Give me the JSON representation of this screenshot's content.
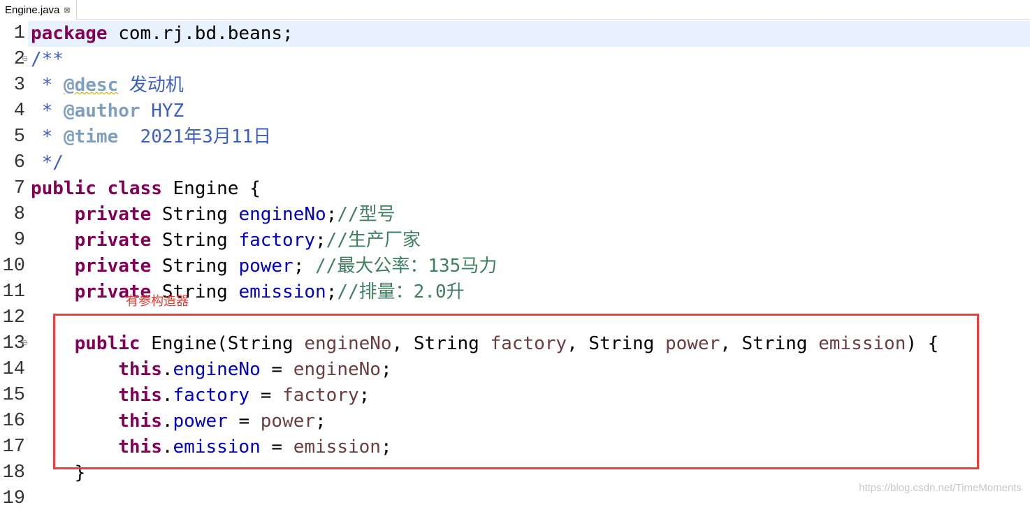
{
  "tab": {
    "title": "Engine.java",
    "close_glyph": "⊠"
  },
  "colors": {
    "keyword": "#7f0055",
    "javadoc": "#3f5fbf",
    "javadoc_tag": "#7f9fbf",
    "field": "#0000c0",
    "parameter": "#6a3e3e",
    "comment": "#3f7f5f",
    "current_line": "#e8f2fe",
    "annotation_red": "#e84040"
  },
  "fold_glyph": "⊖",
  "lines": [
    {
      "num": "1",
      "tokens": [
        {
          "t": "package",
          "c": "kw"
        },
        {
          "t": " com.rj.bd.beans;",
          "c": ""
        }
      ]
    },
    {
      "num": "2",
      "fold": true,
      "tokens": [
        {
          "t": "/**",
          "c": "jd"
        }
      ]
    },
    {
      "num": "3",
      "tokens": [
        {
          "t": " * ",
          "c": "jd"
        },
        {
          "t": "@desc",
          "c": "tag tag-warn"
        },
        {
          "t": " 发动机",
          "c": "jd"
        }
      ]
    },
    {
      "num": "4",
      "tokens": [
        {
          "t": " * ",
          "c": "jd"
        },
        {
          "t": "@author",
          "c": "tag"
        },
        {
          "t": " HYZ",
          "c": "jd"
        }
      ]
    },
    {
      "num": "5",
      "tokens": [
        {
          "t": " * ",
          "c": "jd"
        },
        {
          "t": "@time",
          "c": "tag"
        },
        {
          "t": "  2021年3月11日",
          "c": "jd"
        }
      ]
    },
    {
      "num": "6",
      "tokens": [
        {
          "t": " */",
          "c": "jd"
        }
      ]
    },
    {
      "num": "7",
      "tokens": [
        {
          "t": "public",
          "c": "kw"
        },
        {
          "t": " ",
          "c": ""
        },
        {
          "t": "class",
          "c": "kw"
        },
        {
          "t": " Engine {",
          "c": ""
        }
      ]
    },
    {
      "num": "8",
      "tokens": [
        {
          "t": "    ",
          "c": ""
        },
        {
          "t": "private",
          "c": "kw"
        },
        {
          "t": " String ",
          "c": ""
        },
        {
          "t": "engineNo",
          "c": "fld"
        },
        {
          "t": ";",
          "c": ""
        },
        {
          "t": "//型号",
          "c": "cmt"
        }
      ]
    },
    {
      "num": "9",
      "tokens": [
        {
          "t": "    ",
          "c": ""
        },
        {
          "t": "private",
          "c": "kw"
        },
        {
          "t": " String ",
          "c": ""
        },
        {
          "t": "factory",
          "c": "fld"
        },
        {
          "t": ";",
          "c": ""
        },
        {
          "t": "//生产厂家",
          "c": "cmt"
        }
      ]
    },
    {
      "num": "10",
      "tokens": [
        {
          "t": "    ",
          "c": ""
        },
        {
          "t": "private",
          "c": "kw"
        },
        {
          "t": " String ",
          "c": ""
        },
        {
          "t": "power",
          "c": "fld"
        },
        {
          "t": "; ",
          "c": ""
        },
        {
          "t": "//最大公率：135马力",
          "c": "cmt"
        }
      ]
    },
    {
      "num": "11",
      "tokens": [
        {
          "t": "    ",
          "c": ""
        },
        {
          "t": "private",
          "c": "kw"
        },
        {
          "t": " String ",
          "c": ""
        },
        {
          "t": "emission",
          "c": "fld"
        },
        {
          "t": ";",
          "c": ""
        },
        {
          "t": "//排量：2.0升",
          "c": "cmt"
        }
      ]
    },
    {
      "num": "12",
      "tokens": []
    },
    {
      "num": "13",
      "fold": true,
      "tokens": [
        {
          "t": "    ",
          "c": ""
        },
        {
          "t": "public",
          "c": "kw"
        },
        {
          "t": " Engine(String ",
          "c": ""
        },
        {
          "t": "engineNo",
          "c": "prm"
        },
        {
          "t": ", String ",
          "c": ""
        },
        {
          "t": "factory",
          "c": "prm"
        },
        {
          "t": ", String ",
          "c": ""
        },
        {
          "t": "power",
          "c": "prm"
        },
        {
          "t": ", String ",
          "c": ""
        },
        {
          "t": "emission",
          "c": "prm"
        },
        {
          "t": ") {",
          "c": ""
        }
      ]
    },
    {
      "num": "14",
      "tokens": [
        {
          "t": "        ",
          "c": ""
        },
        {
          "t": "this",
          "c": "kw"
        },
        {
          "t": ".",
          "c": ""
        },
        {
          "t": "engineNo",
          "c": "fld"
        },
        {
          "t": " = ",
          "c": ""
        },
        {
          "t": "engineNo",
          "c": "prm"
        },
        {
          "t": ";",
          "c": ""
        }
      ]
    },
    {
      "num": "15",
      "tokens": [
        {
          "t": "        ",
          "c": ""
        },
        {
          "t": "this",
          "c": "kw"
        },
        {
          "t": ".",
          "c": ""
        },
        {
          "t": "factory",
          "c": "fld"
        },
        {
          "t": " = ",
          "c": ""
        },
        {
          "t": "factory",
          "c": "prm"
        },
        {
          "t": ";",
          "c": ""
        }
      ]
    },
    {
      "num": "16",
      "tokens": [
        {
          "t": "        ",
          "c": ""
        },
        {
          "t": "this",
          "c": "kw"
        },
        {
          "t": ".",
          "c": ""
        },
        {
          "t": "power",
          "c": "fld"
        },
        {
          "t": " = ",
          "c": ""
        },
        {
          "t": "power",
          "c": "prm"
        },
        {
          "t": ";",
          "c": ""
        }
      ]
    },
    {
      "num": "17",
      "tokens": [
        {
          "t": "        ",
          "c": ""
        },
        {
          "t": "this",
          "c": "kw"
        },
        {
          "t": ".",
          "c": ""
        },
        {
          "t": "emission",
          "c": "fld"
        },
        {
          "t": " = ",
          "c": ""
        },
        {
          "t": "emission",
          "c": "prm"
        },
        {
          "t": ";",
          "c": ""
        }
      ]
    },
    {
      "num": "18",
      "tokens": [
        {
          "t": "    }",
          "c": ""
        }
      ]
    },
    {
      "num": "19",
      "tokens": []
    }
  ],
  "annotation": {
    "label": "有参构造器"
  },
  "watermark": "https://blog.csdn.net/TimeMoments"
}
